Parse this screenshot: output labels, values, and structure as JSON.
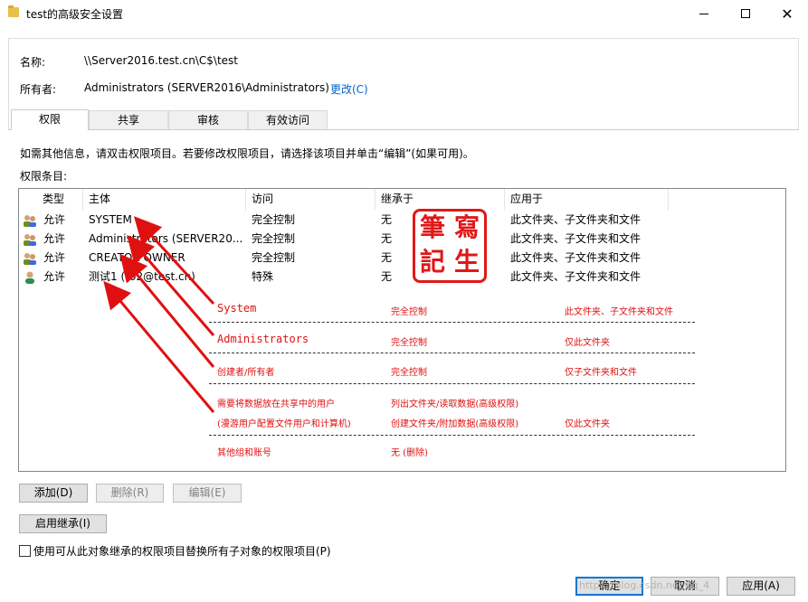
{
  "window": {
    "title": "test的高级安全设置",
    "minimize_glyph": "",
    "maximize_glyph": "",
    "close_glyph": "✕"
  },
  "info": {
    "name_label": "名称:",
    "name_value": "\\\\Server2016.test.cn\\C$\\test",
    "owner_label": "所有者:",
    "owner_value": "Administrators (SERVER2016\\Administrators)",
    "change_link": "更改(C)"
  },
  "tabs": [
    {
      "label": "权限",
      "active": true
    },
    {
      "label": "共享",
      "active": false
    },
    {
      "label": "审核",
      "active": false
    },
    {
      "label": "有效访问",
      "active": false
    }
  ],
  "hint": "如需其他信息，请双击权限项目。若要修改权限项目，请选择该项目并单击“编辑”(如果可用)。",
  "entries_label": "权限条目:",
  "table": {
    "columns": [
      "类型",
      "主体",
      "访问",
      "继承于",
      "应用于"
    ],
    "rows": [
      {
        "icon": "group-icon",
        "type": "允许",
        "principal": "SYSTEM",
        "access": "完全控制",
        "inherited": "无",
        "applies": "此文件夹、子文件夹和文件"
      },
      {
        "icon": "group-icon",
        "type": "允许",
        "principal": "Administrators (SERVER20...",
        "access": "完全控制",
        "inherited": "无",
        "applies": "此文件夹、子文件夹和文件"
      },
      {
        "icon": "group-icon",
        "type": "允许",
        "principal": "CREATOR OWNER",
        "access": "完全控制",
        "inherited": "无",
        "applies": "此文件夹、子文件夹和文件"
      },
      {
        "icon": "user-icon",
        "type": "允许",
        "principal": "测试1 (t02@test.cn)",
        "access": "特殊",
        "inherited": "无",
        "applies": "此文件夹、子文件夹和文件"
      }
    ]
  },
  "annotations": {
    "rows": [
      {
        "a": "System",
        "b": "完全控制",
        "c": "此文件夹、子文件夹和文件"
      },
      {
        "a": "Administrators",
        "b": "完全控制",
        "c": "仅此文件夹"
      },
      {
        "a": "创建者/所有者",
        "b": "完全控制",
        "c": "仅子文件夹和文件"
      },
      {
        "a": "需要将数据放在共享中的用户",
        "b": "列出文件夹/读取数据(高级权限)",
        "c": ""
      },
      {
        "a": "(漫游用户配置文件用户和计算机)",
        "b": "创建文件夹/附加数据(高级权限)",
        "c": "仅此文件夹"
      },
      {
        "a": "其他组和账号",
        "b": "无 (删除)",
        "c": ""
      }
    ],
    "color": "#e01010"
  },
  "seal": {
    "chars": [
      "筆",
      "寫",
      "記",
      "生"
    ],
    "color": "#e01818"
  },
  "buttons": {
    "add": "添加(D)",
    "remove": "删除(R)",
    "edit": "编辑(E)",
    "enable_inheritance": "启用继承(I)",
    "ok": "确定",
    "cancel": "取消",
    "apply": "应用(A)"
  },
  "replace_child_checkbox": {
    "label": "使用可从此对象继承的权限项目替换所有子对象的权限项目(P)",
    "checked": false
  },
  "watermark": "https://blog.csdn.net/qq_4"
}
